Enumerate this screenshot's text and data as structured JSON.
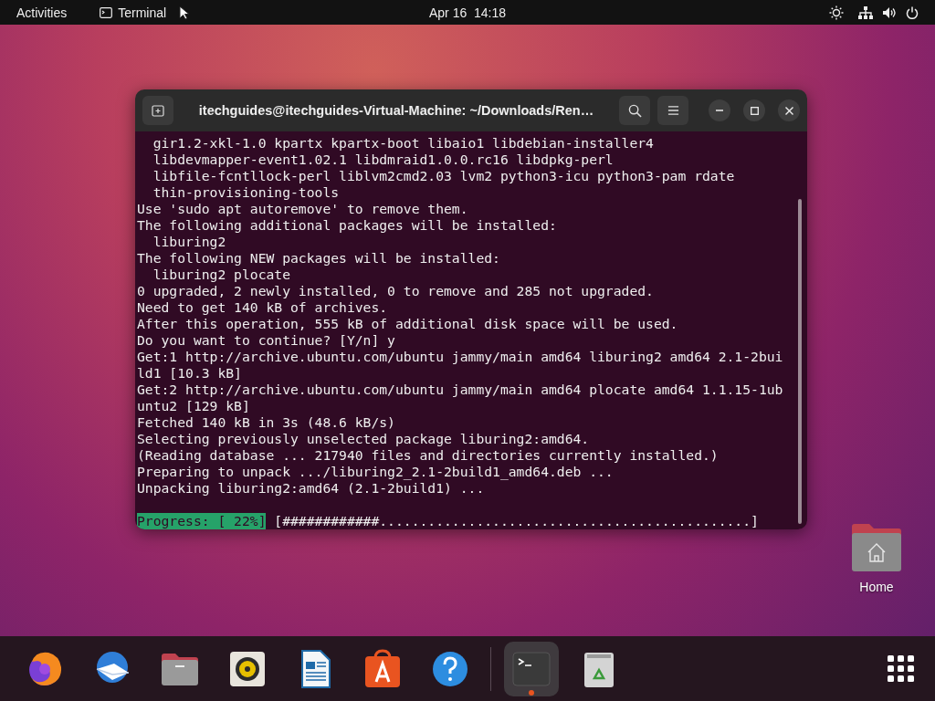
{
  "top_bar": {
    "activities": "Activities",
    "app_menu": "Terminal",
    "clock": "Apr 16  14:18"
  },
  "terminal": {
    "title": "itechguides@itechguides-Virtual-Machine: ~/Downloads/Ren…",
    "lines": [
      "  gir1.2-xkl-1.0 kpartx kpartx-boot libaio1 libdebian-installer4",
      "  libdevmapper-event1.02.1 libdmraid1.0.0.rc16 libdpkg-perl",
      "  libfile-fcntllock-perl liblvm2cmd2.03 lvm2 python3-icu python3-pam rdate",
      "  thin-provisioning-tools",
      "Use 'sudo apt autoremove' to remove them.",
      "The following additional packages will be installed:",
      "  liburing2",
      "The following NEW packages will be installed:",
      "  liburing2 plocate",
      "0 upgraded, 2 newly installed, 0 to remove and 285 not upgraded.",
      "Need to get 140 kB of archives.",
      "After this operation, 555 kB of additional disk space will be used.",
      "Do you want to continue? [Y/n] y",
      "Get:1 http://archive.ubuntu.com/ubuntu jammy/main amd64 liburing2 amd64 2.1-2bui",
      "ld1 [10.3 kB]",
      "Get:2 http://archive.ubuntu.com/ubuntu jammy/main amd64 plocate amd64 1.1.15-1ub",
      "untu2 [129 kB]",
      "Fetched 140 kB in 3s (48.6 kB/s)",
      "Selecting previously unselected package liburing2:amd64.",
      "(Reading database ... 217940 files and directories currently installed.)",
      "Preparing to unpack .../liburing2_2.1-2build1_amd64.deb ...",
      "Unpacking liburing2:amd64 (2.1-2build1) ..."
    ],
    "progress": {
      "label": "Progress: [ 22%]",
      "bar": "[############..............................................]"
    }
  },
  "desktop_icons": [
    {
      "label": "Home"
    }
  ],
  "dock": {
    "items": [
      {
        "kind": "browser",
        "running": false
      },
      {
        "kind": "mail",
        "running": false
      },
      {
        "kind": "files",
        "running": false
      },
      {
        "kind": "music",
        "running": false
      },
      {
        "kind": "writer",
        "running": false
      },
      {
        "kind": "software",
        "running": false
      },
      {
        "kind": "help",
        "running": false
      },
      {
        "kind": "separator"
      },
      {
        "kind": "terminal",
        "running": true
      },
      {
        "kind": "trash",
        "running": false
      }
    ]
  }
}
